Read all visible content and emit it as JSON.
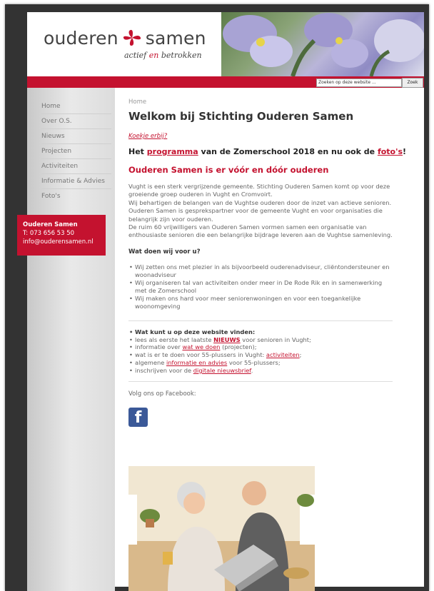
{
  "header": {
    "logo_left": "ouderen",
    "logo_right": "samen",
    "tagline_pre": "actief",
    "tagline_mid": "en",
    "tagline_post": "betrokken",
    "accent_color": "#c4122f"
  },
  "search": {
    "placeholder": "Zoeken op deze website ...",
    "button_label": "Zoek"
  },
  "nav": {
    "items": [
      {
        "label": "Home"
      },
      {
        "label": "Over O.S."
      },
      {
        "label": "Nieuws"
      },
      {
        "label": "Projecten"
      },
      {
        "label": "Activiteiten"
      },
      {
        "label": "Informatie & Advies"
      },
      {
        "label": "Foto's"
      }
    ]
  },
  "contact": {
    "name": "Ouderen Samen",
    "phone": "T: 073 656 53 50",
    "email": "info@ouderensamen.nl"
  },
  "main": {
    "breadcrumb": "Home",
    "title": "Welkom bij Stichting Ouderen Samen",
    "koekie": "Koekje erbij?",
    "prog_pre": "Het ",
    "prog_link": "programma",
    "prog_mid": " van de Zomerschool 2018 en nu ook de ",
    "prog_link2": "foto's",
    "prog_end": "!",
    "heading_red": "Ouderen Samen is er vóór en dóór ouderen",
    "para1": "Vught is een sterk vergrijzende gemeente. Stichting Ouderen Samen komt op voor deze groeiende groep ouderen in Vught en Cromvoirt.",
    "para2": "Wij behartigen de belangen van de Vughtse ouderen door de inzet van actieve senioren. Ouderen Samen is gesprekspartner voor de gemeente Vught en voor organisaties die belangrijk zijn voor ouderen.",
    "para3": "De ruim 60 vrijwilligers van Ouderen Samen vormen samen een organisatie van enthousiaste senioren die een belangrijke bijdrage leveren aan de Vughtse samenleving.",
    "doen_heading": "Wat doen wij voor u?",
    "doen_items": [
      "Wij zetten ons met plezier in als bijvoorbeeld ouderenadviseur, cliëntondersteuner en woonadviseur",
      "Wij organiseren tal van activiteiten onder meer in De Rode Rik en in samenwerking met de Zomerschool",
      "Wij maken ons hard voor meer seniorenwoningen en voor een toegankelijke woonomgeving"
    ],
    "vinden_heading": "Wat kunt u op deze website vinden:",
    "vinden": {
      "i1_pre": "lees als eerste het laatste ",
      "i1_link": "NIEUWS",
      "i1_post": " voor senioren in Vught;",
      "i2_pre": "informatie over ",
      "i2_link": "wat we doen",
      "i2_post": " (projecten);",
      "i3_pre": "wat is er te doen voor 55-plussers in Vught: ",
      "i3_link": "activiteiten",
      "i3_post": ";",
      "i4_pre": "algemene ",
      "i4_link": "informatie en advies",
      "i4_post": " voor 55-plussers;",
      "i5_pre": "inschrijven voor de ",
      "i5_link": "digitale nieuwsbrief",
      "i5_post": "."
    },
    "follow": "Volg ons op Facebook:",
    "facebook_icon": "facebook-icon"
  }
}
